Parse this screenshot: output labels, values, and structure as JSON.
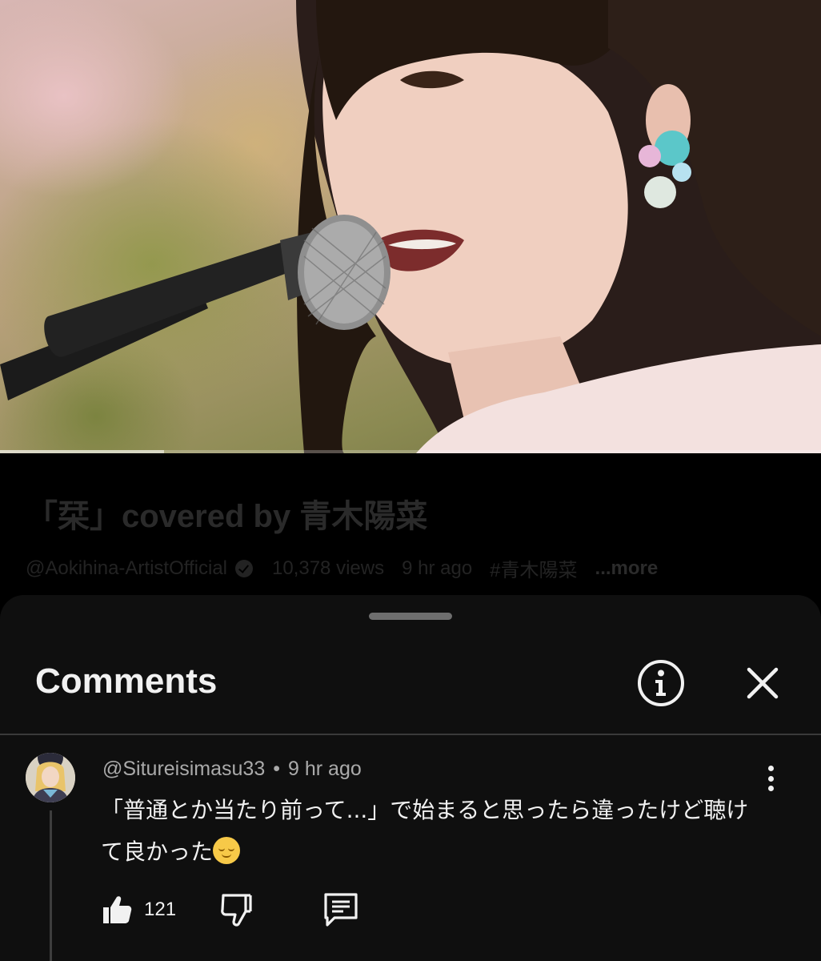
{
  "video": {
    "progress": 0.2
  },
  "video_info": {
    "title": "「栞」covered by 青木陽菜",
    "channel": "@Aokihina-ArtistOfficial",
    "views": "10,378 views",
    "age": "9 hr ago",
    "hashtag": "#青木陽菜",
    "more": "...more"
  },
  "comments_sheet": {
    "title": "Comments",
    "icons": {
      "info": "info-icon",
      "close": "close-icon"
    },
    "comment": {
      "author": "@Situreisimasu33",
      "separator": "•",
      "time": "9 hr ago",
      "text": "「普通とか当たり前って...」で始まると思ったら違ったけど聴けて良かった",
      "emoji": "relieved-face-emoji",
      "likes": "121",
      "actions": [
        "like-icon",
        "dislike-icon",
        "reply-icon"
      ],
      "menu_icon": "more-vert-icon"
    }
  }
}
